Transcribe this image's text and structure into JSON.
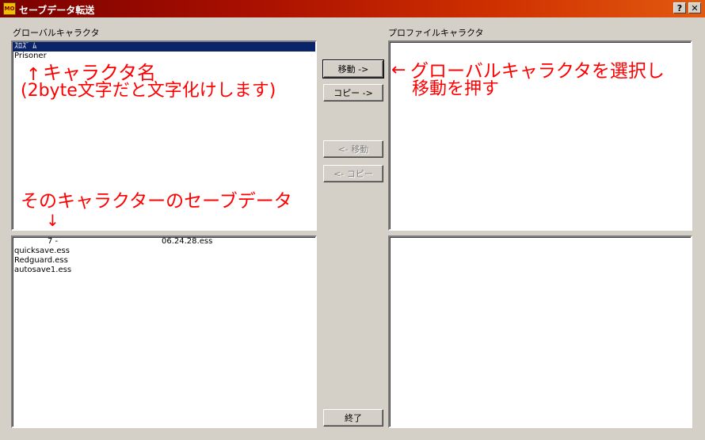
{
  "window": {
    "title": "セーブデータ転送",
    "app_icon_text": "MO",
    "help_label": "?",
    "close_label": "✕"
  },
  "global_panel": {
    "label": "グローバルキャラクタ",
    "characters": [
      "ｽﾛｽﾞ ﾑ",
      "Prisoner"
    ],
    "saves": [
      {
        "name": "7 -",
        "date": "06.24.28.ess"
      },
      {
        "name": "quicksave.ess",
        "date": ""
      },
      {
        "name": "Redguard.ess",
        "date": ""
      },
      {
        "name": "autosave1.ess",
        "date": ""
      }
    ]
  },
  "profile_panel": {
    "label": "プロファイルキャラクタ"
  },
  "buttons": {
    "move_right": "移動 ->",
    "copy_right": "コピー ->",
    "move_left": "<- 移動",
    "copy_left": "<- コピー",
    "exit": "終了"
  },
  "annotations": {
    "char_name_arrow": "↑",
    "char_name": "キャラクタ名",
    "char_name_note": "(2byte文字だと文字化けします)",
    "save_data": "そのキャラクターのセーブデータ",
    "save_data_arrow": "↓",
    "select_hint_arrow": "←",
    "select_hint_line1": "グローバルキャラクタを選択し",
    "select_hint_line2": "移動を押す"
  },
  "colors": {
    "annotation": "#ff0000",
    "selection": "#0a246a",
    "window_bg": "#d4d0c8"
  }
}
